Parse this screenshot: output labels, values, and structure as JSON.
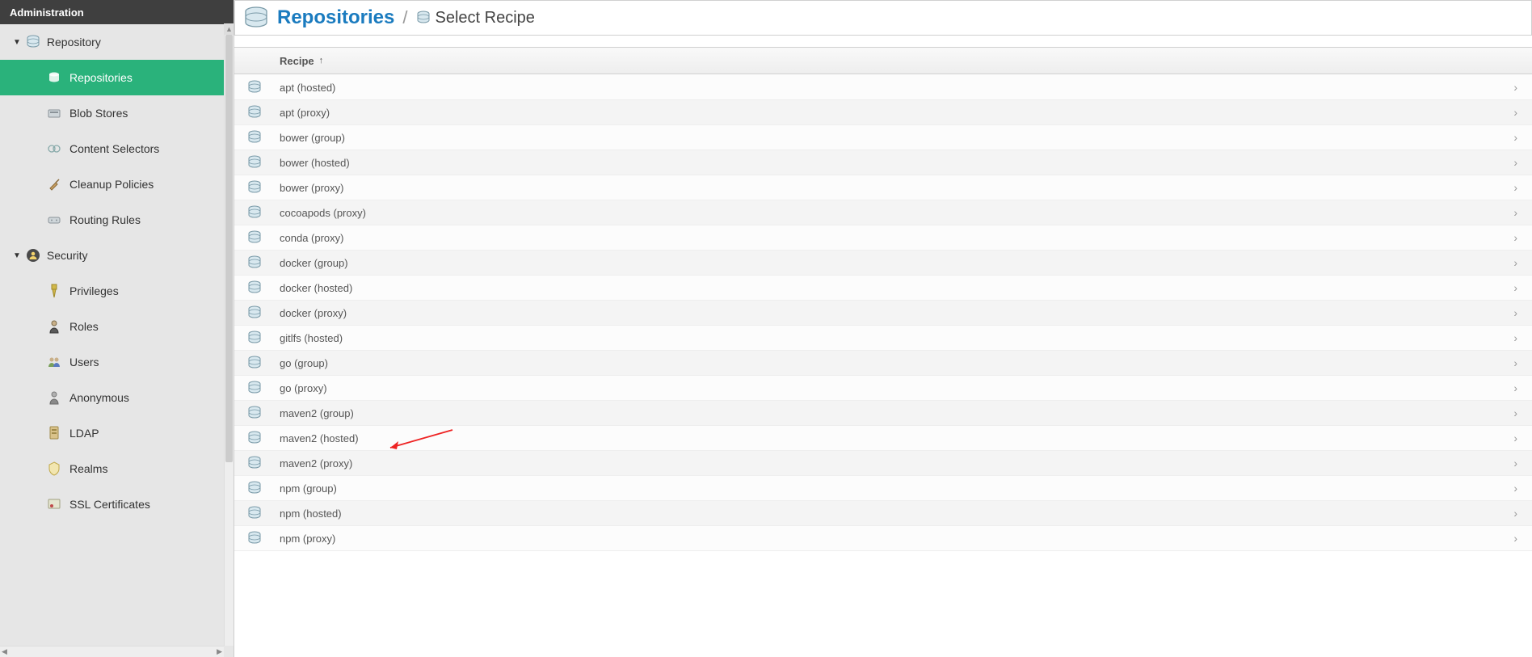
{
  "sidebar": {
    "title": "Administration",
    "sections": [
      {
        "label": "Repository",
        "icon": "database-icon",
        "items": [
          {
            "label": "Repositories",
            "icon": "database-small-icon",
            "active": true
          },
          {
            "label": "Blob Stores",
            "icon": "blob-icon",
            "active": false
          },
          {
            "label": "Content Selectors",
            "icon": "selectors-icon",
            "active": false
          },
          {
            "label": "Cleanup Policies",
            "icon": "broom-icon",
            "active": false
          },
          {
            "label": "Routing Rules",
            "icon": "routing-icon",
            "active": false
          }
        ]
      },
      {
        "label": "Security",
        "icon": "security-icon",
        "items": [
          {
            "label": "Privileges",
            "icon": "privileges-icon",
            "active": false
          },
          {
            "label": "Roles",
            "icon": "roles-icon",
            "active": false
          },
          {
            "label": "Users",
            "icon": "users-icon",
            "active": false
          },
          {
            "label": "Anonymous",
            "icon": "anonymous-icon",
            "active": false
          },
          {
            "label": "LDAP",
            "icon": "ldap-icon",
            "active": false
          },
          {
            "label": "Realms",
            "icon": "realms-icon",
            "active": false
          },
          {
            "label": "SSL Certificates",
            "icon": "ssl-icon",
            "active": false
          }
        ]
      }
    ]
  },
  "breadcrumb": {
    "root": "Repositories",
    "current": "Select Recipe"
  },
  "table": {
    "column": "Recipe"
  },
  "recipes": [
    "apt (hosted)",
    "apt (proxy)",
    "bower (group)",
    "bower (hosted)",
    "bower (proxy)",
    "cocoapods (proxy)",
    "conda (proxy)",
    "docker (group)",
    "docker (hosted)",
    "docker (proxy)",
    "gitlfs (hosted)",
    "go (group)",
    "go (proxy)",
    "maven2 (group)",
    "maven2 (hosted)",
    "maven2 (proxy)",
    "npm (group)",
    "npm (hosted)",
    "npm (proxy)"
  ]
}
